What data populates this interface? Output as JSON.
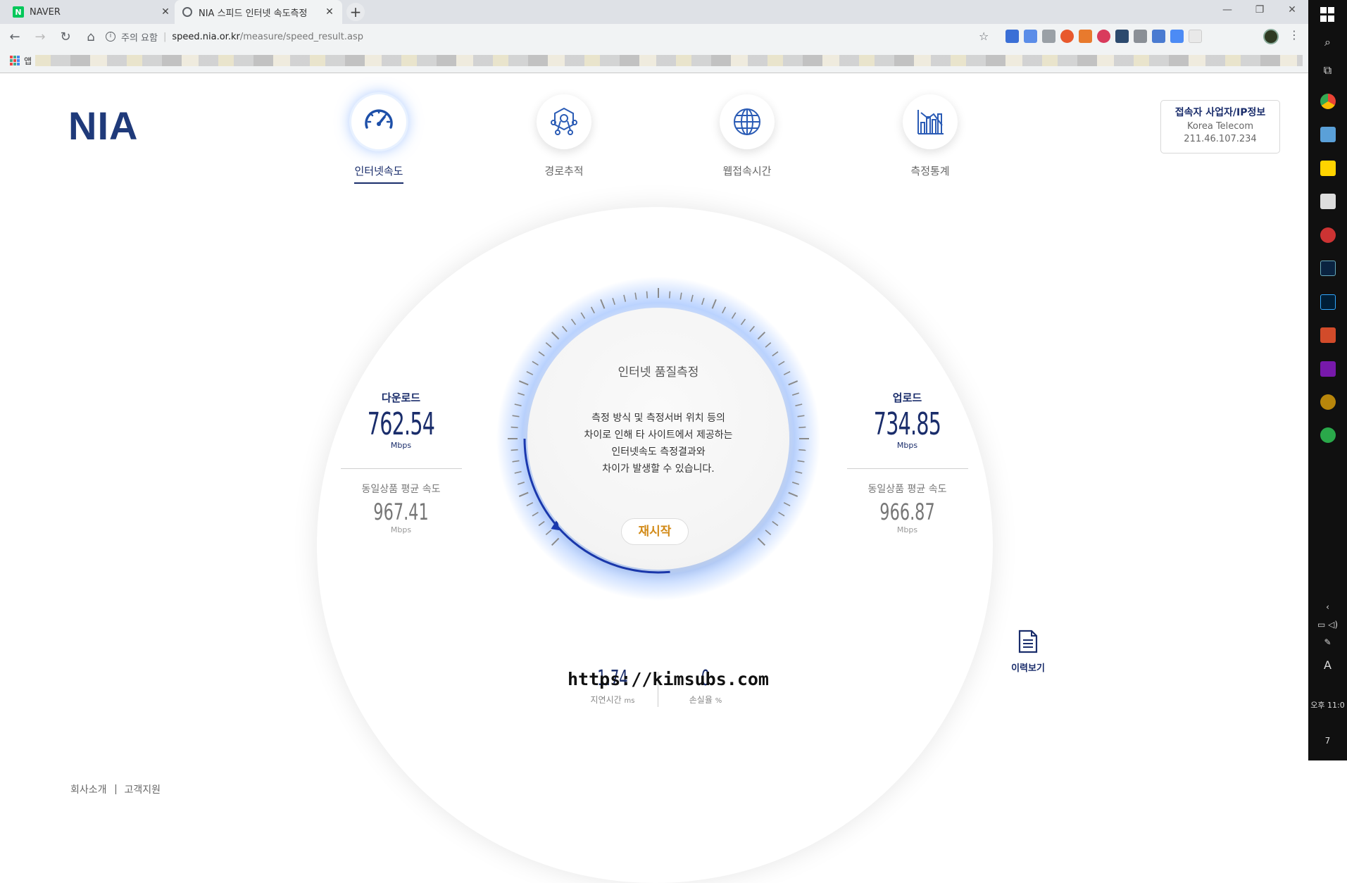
{
  "browser": {
    "tabs": [
      {
        "title": "NAVER",
        "favicon": "naver-icon",
        "active": false
      },
      {
        "title": "NIA 스피드 인터넷 속도측정",
        "favicon": "globe-icon",
        "active": true
      }
    ],
    "address": {
      "security_label": "주의 요함",
      "host": "speed.nia.or.kr",
      "path": "/measure/speed_result.asp"
    },
    "bookmarks": {
      "apps_label": "앱"
    }
  },
  "site": {
    "logo": "NIA",
    "nav": [
      {
        "label": "인터넷속도",
        "icon": "speedometer-icon",
        "active": true
      },
      {
        "label": "경로추적",
        "icon": "route-icon",
        "active": false
      },
      {
        "label": "웹접속시간",
        "icon": "web-globe-icon",
        "active": false
      },
      {
        "label": "측정통계",
        "icon": "stats-icon",
        "active": false
      }
    ],
    "ip_info": {
      "title": "접속자 사업자/IP정보",
      "isp": "Korea Telecom",
      "ip": "211.46.107.234"
    }
  },
  "measure": {
    "download": {
      "label": "다운로드",
      "value": "762.54",
      "unit": "Mbps",
      "avg_label": "동일상품 평균 속도",
      "avg_value": "967.41",
      "avg_unit": "Mbps"
    },
    "upload": {
      "label": "업로드",
      "value": "734.85",
      "unit": "Mbps",
      "avg_label": "동일상품 평균 속도",
      "avg_value": "966.87",
      "avg_unit": "Mbps"
    },
    "center": {
      "title": "인터넷 품질측정",
      "lines": [
        "측정 방식 및 측정서버 위치 등의",
        "차이로 인해 타 사이트에서 제공하는",
        "인터넷속도 측정결과와",
        "차이가 발생할 수 있습니다."
      ],
      "restart_label": "재시작"
    },
    "latency": {
      "value": "1.74",
      "label": "지연시간",
      "unit": "ms"
    },
    "loss": {
      "value": "0",
      "label": "손실율",
      "unit": "%"
    },
    "history_label": "이력보기"
  },
  "watermark": "https://kimsubs.com",
  "footer": {
    "links": [
      "회사소개",
      "고객지원"
    ]
  },
  "taskbar": {
    "time": "오후 11:0",
    "notifications": "7",
    "ime": "A"
  },
  "colors": {
    "brand": "#1a2d6b",
    "accent": "#d28a17",
    "glow": "#3c82ff"
  }
}
